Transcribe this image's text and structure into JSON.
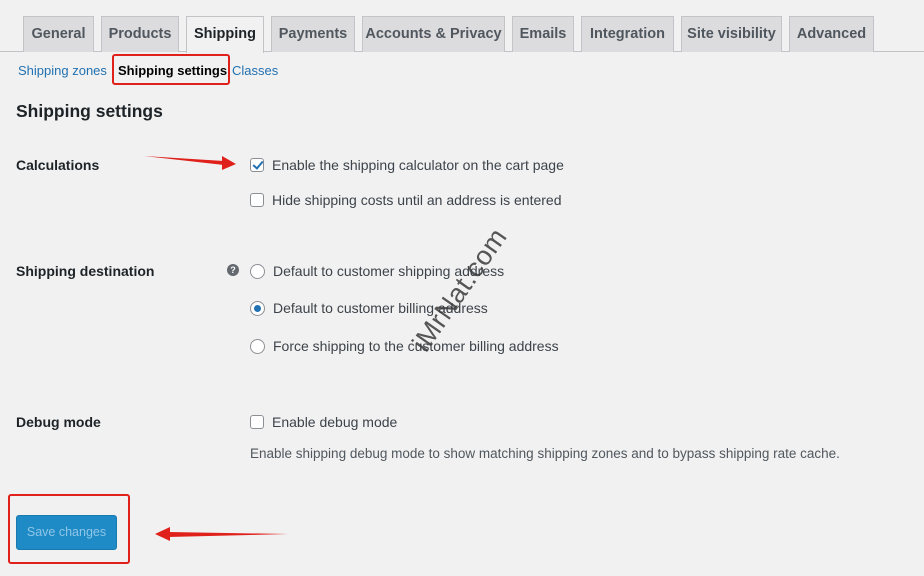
{
  "tabs": [
    {
      "label": "General",
      "active": false
    },
    {
      "label": "Products",
      "active": false
    },
    {
      "label": "Shipping",
      "active": true
    },
    {
      "label": "Payments",
      "active": false
    },
    {
      "label": "Accounts & Privacy",
      "active": false
    },
    {
      "label": "Emails",
      "active": false
    },
    {
      "label": "Integration",
      "active": false
    },
    {
      "label": "Site visibility",
      "active": false
    },
    {
      "label": "Advanced",
      "active": false
    }
  ],
  "subnav": {
    "zones": "Shipping zones",
    "settings": "Shipping settings",
    "classes": "Classes",
    "separator": "|"
  },
  "page": {
    "title": "Shipping settings"
  },
  "calculations": {
    "label": "Calculations",
    "options": [
      {
        "label": "Enable the shipping calculator on the cart page",
        "checked": true
      },
      {
        "label": "Hide shipping costs until an address is entered",
        "checked": false
      }
    ]
  },
  "destination": {
    "label": "Shipping destination",
    "help_icon": "?",
    "options": [
      {
        "label": "Default to customer shipping address",
        "checked": false
      },
      {
        "label": "Default to customer billing address",
        "checked": true
      },
      {
        "label": "Force shipping to the customer billing address",
        "checked": false
      }
    ]
  },
  "debug": {
    "label": "Debug mode",
    "option": {
      "label": "Enable debug mode",
      "checked": false
    },
    "description": "Enable shipping debug mode to show matching shipping zones and to bypass shipping rate cache."
  },
  "save_button": "Save changes",
  "watermark": "iMrNat.com",
  "colors": {
    "background": "#f1f1f1",
    "link": "#2271b1",
    "primary_button": "#1f8bc6",
    "annotation_red": "#e0201a"
  }
}
